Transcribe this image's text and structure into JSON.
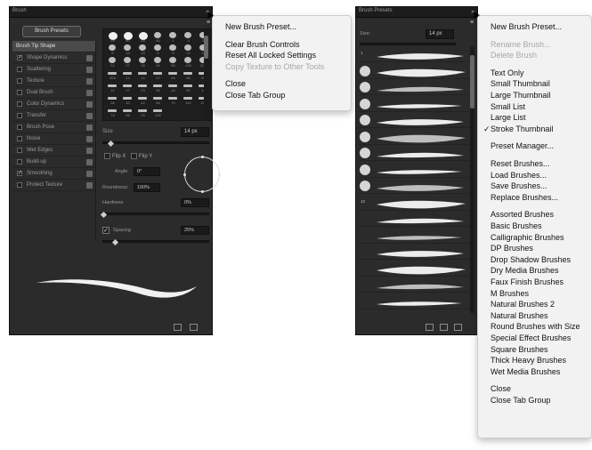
{
  "brush_panel": {
    "tab": "Brush",
    "brush_presets_button": "Brush Presets",
    "sections": [
      {
        "label": "Brush Tip Shape",
        "header": true,
        "checked": false
      },
      {
        "label": "Shape Dynamics",
        "checked": true
      },
      {
        "label": "Scattering",
        "checked": false
      },
      {
        "label": "Texture",
        "checked": false
      },
      {
        "label": "Dual Brush",
        "checked": false
      },
      {
        "label": "Color Dynamics",
        "checked": false
      },
      {
        "label": "Transfer",
        "checked": false
      },
      {
        "label": "Brush Pose",
        "checked": false
      },
      {
        "label": "Noise",
        "checked": false
      },
      {
        "label": "Wet Edges",
        "checked": false
      },
      {
        "label": "Build-up",
        "checked": false
      },
      {
        "label": "Smoothing",
        "checked": true
      },
      {
        "label": "Protect Texture",
        "checked": false
      }
    ],
    "tip_numbers": [
      "25",
      "50",
      "25",
      "50",
      "1",
      "3",
      "5",
      "9",
      "13",
      "19",
      "5",
      "9",
      "13",
      "17",
      "21",
      "27",
      "35",
      "45",
      "65",
      "100",
      "200",
      "300",
      "14",
      "24",
      "27",
      "39",
      "46",
      "59",
      "11",
      "17",
      "23",
      "36",
      "44",
      "60",
      "14",
      "26",
      "33",
      "42",
      "55",
      "70",
      "112",
      "134",
      "74",
      "95",
      "29",
      "192"
    ],
    "size_label": "Size",
    "size_value": "14 px",
    "flip_x": "Flip X",
    "flip_y": "Flip Y",
    "angle_label": "Angle:",
    "angle_value": "0°",
    "roundness_label": "Roundness:",
    "roundness_value": "100%",
    "hardness_label": "Hardness",
    "hardness_value": "0%",
    "spacing_label": "Spacing",
    "spacing_value": "25%"
  },
  "brush_menu": {
    "groups": [
      [
        {
          "label": "New Brush Preset...",
          "disabled": false
        }
      ],
      [
        {
          "label": "Clear Brush Controls",
          "disabled": false
        },
        {
          "label": "Reset All Locked Settings",
          "disabled": false
        },
        {
          "label": "Copy Texture to Other Tools",
          "disabled": true
        }
      ],
      [
        {
          "label": "Close",
          "disabled": false
        },
        {
          "label": "Close Tab Group",
          "disabled": false
        }
      ]
    ]
  },
  "presets_panel": {
    "tab": "Brush Presets",
    "size_label": "Size:",
    "size_value": "14 px",
    "rows": [
      {
        "num": "1",
        "thumb": false
      },
      {
        "num": "",
        "thumb": true
      },
      {
        "num": "",
        "thumb": true
      },
      {
        "num": "",
        "thumb": true
      },
      {
        "num": "",
        "thumb": true
      },
      {
        "num": "",
        "thumb": true
      },
      {
        "num": "",
        "thumb": true
      },
      {
        "num": "",
        "thumb": true
      },
      {
        "num": "",
        "thumb": true
      },
      {
        "num": "10",
        "thumb": false
      },
      {
        "num": "",
        "thumb": false
      },
      {
        "num": "",
        "thumb": false
      },
      {
        "num": "",
        "thumb": false
      },
      {
        "num": "",
        "thumb": false
      },
      {
        "num": "",
        "thumb": false
      },
      {
        "num": "",
        "thumb": false
      }
    ]
  },
  "presets_menu": {
    "groups": [
      [
        {
          "label": "New Brush Preset...",
          "disabled": false
        }
      ],
      [
        {
          "label": "Rename Brush...",
          "disabled": true
        },
        {
          "label": "Delete Brush",
          "disabled": true
        }
      ],
      [
        {
          "label": "Text Only",
          "disabled": false
        },
        {
          "label": "Small Thumbnail",
          "disabled": false
        },
        {
          "label": "Large Thumbnail",
          "disabled": false
        },
        {
          "label": "Small List",
          "disabled": false
        },
        {
          "label": "Large List",
          "disabled": false
        },
        {
          "label": "Stroke Thumbnail",
          "disabled": false,
          "checked": true
        }
      ],
      [
        {
          "label": "Preset Manager...",
          "disabled": false
        }
      ],
      [
        {
          "label": "Reset Brushes...",
          "disabled": false
        },
        {
          "label": "Load Brushes...",
          "disabled": false
        },
        {
          "label": "Save Brushes...",
          "disabled": false
        },
        {
          "label": "Replace Brushes...",
          "disabled": false
        }
      ],
      [
        {
          "label": "Assorted Brushes",
          "disabled": false
        },
        {
          "label": "Basic Brushes",
          "disabled": false
        },
        {
          "label": "Calligraphic Brushes",
          "disabled": false
        },
        {
          "label": "DP Brushes",
          "disabled": false
        },
        {
          "label": "Drop Shadow Brushes",
          "disabled": false
        },
        {
          "label": "Dry Media Brushes",
          "disabled": false
        },
        {
          "label": "Faux Finish Brushes",
          "disabled": false
        },
        {
          "label": "M Brushes",
          "disabled": false
        },
        {
          "label": "Natural Brushes 2",
          "disabled": false
        },
        {
          "label": "Natural Brushes",
          "disabled": false
        },
        {
          "label": "Round Brushes with Size",
          "disabled": false
        },
        {
          "label": "Special Effect Brushes",
          "disabled": false
        },
        {
          "label": "Square Brushes",
          "disabled": false
        },
        {
          "label": "Thick Heavy Brushes",
          "disabled": false
        },
        {
          "label": "Wet Media Brushes",
          "disabled": false
        }
      ],
      [
        {
          "label": "Close",
          "disabled": false
        },
        {
          "label": "Close Tab Group",
          "disabled": false
        }
      ]
    ]
  },
  "colors": {
    "panel_bg": "#2b2b2b",
    "menu_bg": "#f2f2f2",
    "disabled_text": "#a8a8a8"
  },
  "icons": [
    "collapse-arrows-icon",
    "panel-menu-icon",
    "lock-icon",
    "check-icon",
    "new-preset-icon",
    "create-brush-icon",
    "trash-icon",
    "mouse-cursor-icon"
  ]
}
